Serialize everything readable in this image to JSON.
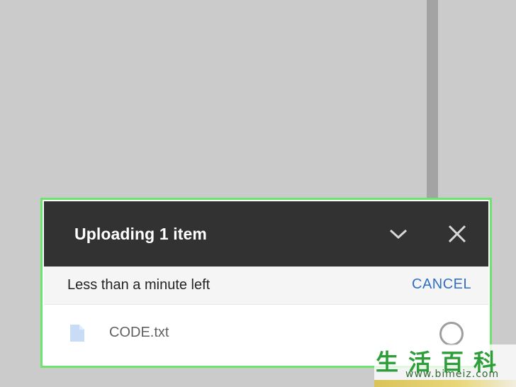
{
  "upload_panel": {
    "title": "Uploading 1 item",
    "collapse_icon": "chevron-down-icon",
    "close_icon": "close-icon",
    "status_text": "Less than a minute left",
    "cancel_label": "CANCEL",
    "files": [
      {
        "name": "CODE.txt",
        "icon": "document-icon",
        "status_icon": "progress-circle-icon"
      }
    ]
  },
  "watermark": {
    "characters": "生活百科",
    "url": "www.bimeiz.com"
  },
  "colors": {
    "background": "#cbcbcb",
    "header": "#323232",
    "accent_link": "#2f6fc7",
    "highlight_outline": "#6ee36e",
    "file_icon": "#c9dcf5"
  }
}
